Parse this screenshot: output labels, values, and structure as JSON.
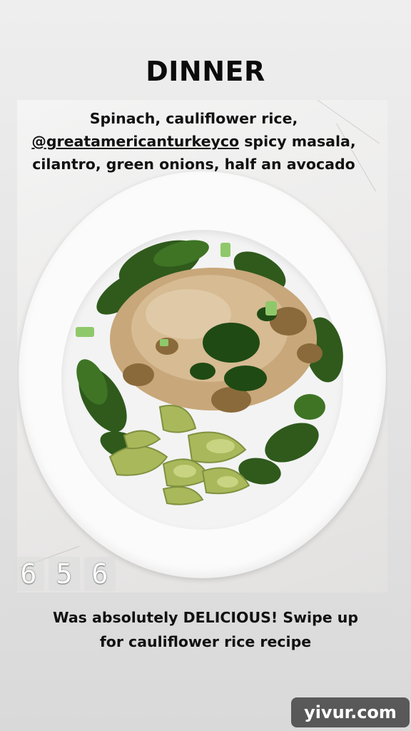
{
  "story": {
    "title": "DINNER",
    "caption_top": [
      "Spinach, cauliflower rice,",
      "@greatamericanturkeyco",
      " spicy masala,",
      "cilantro, green onions, half an avocado"
    ],
    "timer_digits": [
      "6",
      "5",
      "6"
    ],
    "caption_bottom": [
      "Was absolutely DELICIOUS! Swipe up",
      "for cauliflower rice recipe"
    ],
    "watermark": "yivur.com"
  },
  "colors": {
    "background": "#e6e6e6",
    "text": "#111111",
    "spinach": "#2f5a1c",
    "avocado": "#a9b85a",
    "rice": "#c8a77a"
  }
}
